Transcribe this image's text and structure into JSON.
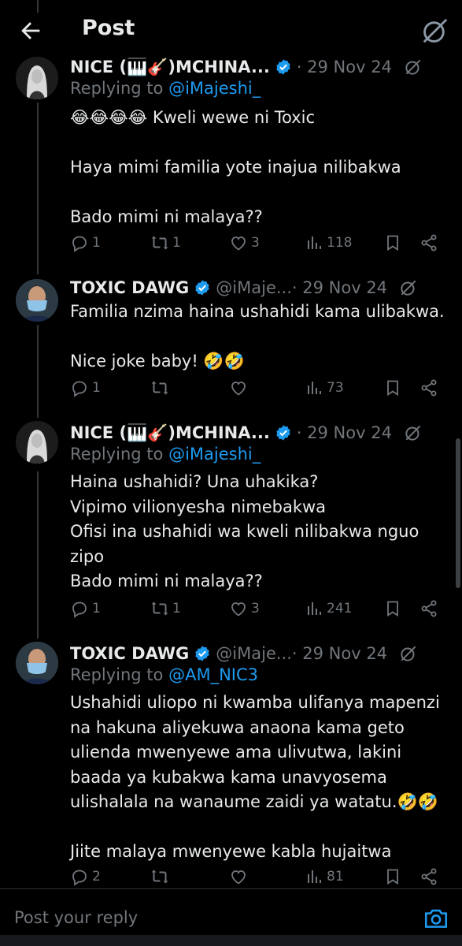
{
  "header": {
    "title": "Post"
  },
  "tweets": [
    {
      "name": "NICE (🎹🎸)MCHINA...",
      "handle": "",
      "date": "· 29 Nov 24",
      "replying_label": "Replying to",
      "replying_to": "@iMajeshi_",
      "lines": [
        "😂😂😂😂 Kweli wewe ni Toxic",
        "",
        "Haya mimi familia yote inajua nilibakwa",
        "",
        "Bado mimi ni malaya??"
      ],
      "replies": "1",
      "reposts": "1",
      "likes": "3",
      "views": "118"
    },
    {
      "name": "TOXIC DAWG",
      "handle": "@iMaje...",
      "date": "· 29 Nov 24",
      "replying_label": "",
      "replying_to": "",
      "lines": [
        "Familia nzima haina ushahidi kama ulibakwa.",
        "",
        "Nice joke baby! 🤣🤣"
      ],
      "replies": "1",
      "reposts": "",
      "likes": "",
      "views": "73"
    },
    {
      "name": "NICE (🎹🎸)MCHINA...",
      "handle": "",
      "date": "· 29 Nov 24",
      "replying_label": "Replying to",
      "replying_to": "@iMajeshi_",
      "lines": [
        "Haina ushahidi? Una uhakika?",
        "Vipimo vilionyesha nimebakwa",
        "Ofisi ina ushahidi wa kweli nilibakwa nguo",
        "zipo",
        "Bado mimi ni malaya??"
      ],
      "replies": "1",
      "reposts": "1",
      "likes": "3",
      "views": "241"
    },
    {
      "name": "TOXIC DAWG",
      "handle": "@iMaje...",
      "date": "· 29 Nov 24",
      "replying_label": "Replying to",
      "replying_to": "@AM_NIC3",
      "lines": [
        "Ushahidi uliopo ni kwamba ulifanya mapenzi",
        "na hakuna aliyekuwa anaona kama geto",
        "ulienda mwenyewe ama ulivutwa, lakini",
        "baada ya kubakwa kama unavyosema",
        "ulishalala na wanaume zaidi ya watatu.🤣🤣",
        "",
        "Jiite malaya mwenyewe kabla hujaitwa"
      ],
      "replies": "2",
      "reposts": "",
      "likes": "",
      "views": "81"
    }
  ],
  "reply_bar": {
    "placeholder": "Post your reply"
  },
  "icons": {
    "back": "arrow-left-icon",
    "grok": "grok-icon",
    "verified": "verified-badge-icon",
    "reply": "reply-icon",
    "repost": "repost-icon",
    "like": "heart-icon",
    "views": "views-icon",
    "bookmark": "bookmark-icon",
    "share": "share-icon",
    "camera": "camera-icon"
  },
  "colors": {
    "background": "#000000",
    "text": "#e7e9ea",
    "muted": "#71767b",
    "accent": "#1d9bf0",
    "divider": "#2f3336"
  }
}
